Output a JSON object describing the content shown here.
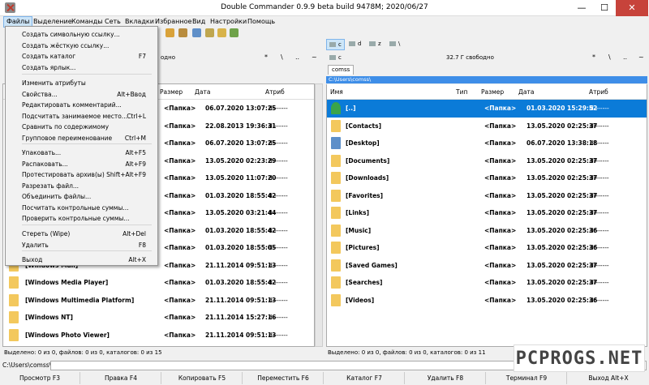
{
  "window": {
    "title": "Double Commander 0.9.9 beta build 9478M; 2020/06/27",
    "minimize": "—",
    "maximize": "☐",
    "close": "✕"
  },
  "menubar": [
    "Файлы",
    "Выделение",
    "Команды",
    "Сеть",
    "Вкладки",
    "Избранное",
    "Вид",
    "Настройки",
    "Помощь"
  ],
  "file_menu": {
    "items": [
      {
        "label": "Создать символьную ссылку...",
        "shortcut": ""
      },
      {
        "label": "Создать жёсткую ссылку...",
        "shortcut": ""
      },
      {
        "label": "Создать каталог",
        "shortcut": "F7"
      },
      {
        "label": "Создать ярлык...",
        "shortcut": ""
      },
      {
        "label": "Изменить атрибуты",
        "shortcut": ""
      },
      {
        "label": "Свойства...",
        "shortcut": "Alt+Ввод"
      },
      {
        "label": "Редактировать комментарий...",
        "shortcut": ""
      },
      {
        "label": "Подсчитать занимаемое место...",
        "shortcut": "Ctrl+L"
      },
      {
        "label": "Сравнить по содержимому",
        "shortcut": ""
      },
      {
        "label": "Групповое переименование",
        "shortcut": "Ctrl+M"
      },
      {
        "label": "Упаковать...",
        "shortcut": "Alt+F5"
      },
      {
        "label": "Распаковать...",
        "shortcut": "Alt+F9"
      },
      {
        "label": "Протестировать архив(ы)",
        "shortcut": "Shift+Alt+F9"
      },
      {
        "label": "Разрезать файл...",
        "shortcut": ""
      },
      {
        "label": "Объединить файлы...",
        "shortcut": ""
      },
      {
        "label": "Посчитать контрольные суммы...",
        "shortcut": ""
      },
      {
        "label": "Проверить контрольные суммы...",
        "shortcut": ""
      },
      {
        "label": "Стереть (Wipe)",
        "shortcut": "Alt+Del"
      },
      {
        "label": "Удалить",
        "shortcut": "F8"
      },
      {
        "label": "Выход",
        "shortcut": "Alt+X"
      }
    ]
  },
  "left_panel": {
    "drive_info": "одно",
    "nav_symbols": [
      "*",
      "\\",
      "..",
      "~"
    ],
    "columns": {
      "size": "Размер",
      "date": "Дата",
      "attr": "Атриб"
    },
    "rows": [
      {
        "name": "",
        "size": "<Папка>",
        "date": "06.07.2020 13:07:25",
        "attr": "d-------"
      },
      {
        "name": "",
        "size": "<Папка>",
        "date": "22.08.2013 19:36:31",
        "attr": "d-------"
      },
      {
        "name": "",
        "size": "<Папка>",
        "date": "06.07.2020 13:07:25",
        "attr": "d-------"
      },
      {
        "name": "",
        "size": "<Папка>",
        "date": "13.05.2020 02:23:29",
        "attr": "d-------"
      },
      {
        "name": "",
        "size": "<Папка>",
        "date": "13.05.2020 11:07:20",
        "attr": "d-------"
      },
      {
        "name": "",
        "size": "<Папка>",
        "date": "01.03.2020 18:55:42",
        "attr": "d-------"
      },
      {
        "name": "",
        "size": "<Папка>",
        "date": "13.05.2020 03:21:44",
        "attr": "d-------"
      },
      {
        "name": "",
        "size": "<Папка>",
        "date": "01.03.2020 18:55:42",
        "attr": "d-------"
      },
      {
        "name": "",
        "size": "<Папка>",
        "date": "01.03.2020 18:55:05",
        "attr": "d-------"
      },
      {
        "name": "[Windows Mail]",
        "size": "<Папка>",
        "date": "21.11.2014 09:51:13",
        "attr": "d-------"
      },
      {
        "name": "[Windows Media Player]",
        "size": "<Папка>",
        "date": "01.03.2020 18:55:42",
        "attr": "d-------"
      },
      {
        "name": "[Windows Multimedia Platform]",
        "size": "<Папка>",
        "date": "21.11.2014 09:51:13",
        "attr": "d-------"
      },
      {
        "name": "[Windows NT]",
        "size": "<Папка>",
        "date": "21.11.2014 15:27:16",
        "attr": "d-------"
      },
      {
        "name": "[Windows Photo Viewer]",
        "size": "<Папка>",
        "date": "21.11.2014 09:51:13",
        "attr": "d-------"
      }
    ],
    "status": "Выделено: 0 из 0, файлов: 0 из 0, каталогов: 0 из 15"
  },
  "right_panel": {
    "drives": [
      {
        "label": "c",
        "active": true
      },
      {
        "label": "d"
      },
      {
        "label": "z"
      },
      {
        "label": "\\"
      }
    ],
    "drive_letter": "c",
    "drive_info": "32.7 Г свободно",
    "nav_symbols": [
      "*",
      "\\",
      "..",
      "~"
    ],
    "tab": "comss",
    "path": "C:\\Users\\comss\\",
    "columns": {
      "name": "Имя",
      "type": "Тип",
      "size": "Размер",
      "date": "Дата",
      "attr": "Атриб"
    },
    "rows": [
      {
        "name": "[..]",
        "size": "<Папка>",
        "date": "01.03.2020 15:29:52",
        "attr": "d-------",
        "selected": true,
        "icon": "up"
      },
      {
        "name": "[Contacts]",
        "size": "<Папка>",
        "date": "13.05.2020 02:25:37",
        "attr": "dr------"
      },
      {
        "name": "[Desktop]",
        "size": "<Папка>",
        "date": "06.07.2020 13:38:18",
        "attr": "dr------"
      },
      {
        "name": "[Documents]",
        "size": "<Папка>",
        "date": "13.05.2020 02:25:37",
        "attr": "dr------"
      },
      {
        "name": "[Downloads]",
        "size": "<Папка>",
        "date": "13.05.2020 02:25:37",
        "attr": "dr------"
      },
      {
        "name": "[Favorites]",
        "size": "<Папка>",
        "date": "13.05.2020 02:25:37",
        "attr": "dr------"
      },
      {
        "name": "[Links]",
        "size": "<Папка>",
        "date": "13.05.2020 02:25:37",
        "attr": "dr------"
      },
      {
        "name": "[Music]",
        "size": "<Папка>",
        "date": "13.05.2020 02:25:36",
        "attr": "dr------"
      },
      {
        "name": "[Pictures]",
        "size": "<Папка>",
        "date": "13.05.2020 02:25:36",
        "attr": "dr------"
      },
      {
        "name": "[Saved Games]",
        "size": "<Папка>",
        "date": "13.05.2020 02:25:37",
        "attr": "dr------"
      },
      {
        "name": "[Searches]",
        "size": "<Папка>",
        "date": "13.05.2020 02:25:37",
        "attr": "dr------"
      },
      {
        "name": "[Videos]",
        "size": "<Папка>",
        "date": "13.05.2020 02:25:36",
        "attr": "dr------"
      }
    ],
    "status": "Выделено: 0 из 0, файлов: 0 из 0, каталогов: 0 из 11"
  },
  "cmdline": {
    "label": "C:\\Users\\comss\\>",
    "value": ""
  },
  "fnkeys": [
    "Просмотр F3",
    "Правка F4",
    "Копировать F5",
    "Переместить F6",
    "Каталог F7",
    "Удалить F8",
    "Терминал F9",
    "Выход Alt+X"
  ],
  "watermark": "PCPROGS.NET",
  "colors": {
    "selection": "#0b7bd8",
    "path_bar": "#3e8ee8",
    "folder": "#f3c85d",
    "close": "#c7433b"
  }
}
